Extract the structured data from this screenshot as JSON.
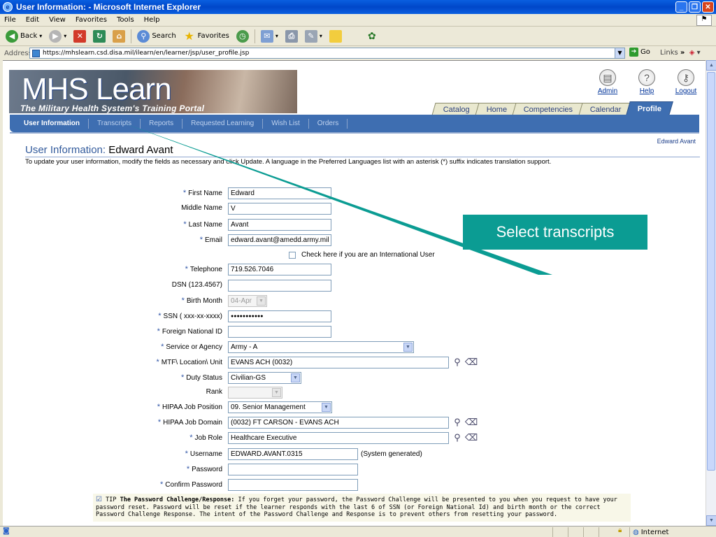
{
  "window": {
    "title": "User Information: - Microsoft Internet Explorer"
  },
  "menu": [
    "File",
    "Edit",
    "View",
    "Favorites",
    "Tools",
    "Help"
  ],
  "toolbar": {
    "back": "Back",
    "search": "Search",
    "favorites": "Favorites"
  },
  "address": {
    "label": "Address",
    "url": "https://mhslearn.csd.disa.mil/ilearn/en/learner/jsp/user_profile.jsp",
    "go": "Go",
    "links": "Links"
  },
  "header": {
    "logo_main": "MHS Learn",
    "logo_sub": "The Military Health System's Training Portal",
    "admin": "Admin",
    "help": "Help",
    "logout": "Logout"
  },
  "tabs": [
    "Catalog",
    "Home",
    "Competencies",
    "Calendar",
    "Profile"
  ],
  "subnav": [
    "User Information",
    "Transcripts",
    "Reports",
    "Requested Learning",
    "Wish List",
    "Orders"
  ],
  "page": {
    "user_right": "Edward Avant",
    "title_prefix": "User Information:",
    "title_name": "Edward Avant",
    "instructions": "To update your user information, modify the fields as necessary and click Update. A language in the Preferred Languages list with an asterisk (*) suffix indicates translation support."
  },
  "form": {
    "first_name": {
      "label": "First Name",
      "value": "Edward"
    },
    "middle_name": {
      "label": "Middle Name",
      "value": "V"
    },
    "last_name": {
      "label": "Last Name",
      "value": "Avant"
    },
    "email": {
      "label": "Email",
      "value": "edward.avant@amedd.army.mil"
    },
    "intl_user": {
      "label": "Check here if you are an International User"
    },
    "telephone": {
      "label": "Telephone",
      "value": "719.526.7046"
    },
    "dsn": {
      "label": "DSN (123.4567)",
      "value": ""
    },
    "birth_month": {
      "label": "Birth Month",
      "value": "04-Apr"
    },
    "ssn": {
      "label": "SSN ( xxx-xx-xxxx)",
      "value": "●●●●●●●●●●●"
    },
    "foreign_id": {
      "label": "Foreign National ID",
      "value": ""
    },
    "service": {
      "label": "Service or Agency",
      "value": "Army - A"
    },
    "mtf": {
      "label": "MTF\\ Location\\ Unit",
      "value": "EVANS ACH (0032)"
    },
    "duty_status": {
      "label": "Duty Status",
      "value": "Civilian-GS"
    },
    "rank": {
      "label": "Rank",
      "value": ""
    },
    "hipaa_position": {
      "label": "HIPAA Job Position",
      "value": "09. Senior Management"
    },
    "hipaa_domain": {
      "label": "HIPAA Job Domain",
      "value": "(0032) FT CARSON - EVANS ACH"
    },
    "job_role": {
      "label": "Job Role",
      "value": "Healthcare Executive"
    },
    "username": {
      "label": "Username",
      "value": "EDWARD.AVANT.0315",
      "note": "(System generated)"
    },
    "password": {
      "label": "Password",
      "value": ""
    },
    "confirm_password": {
      "label": "Confirm Password",
      "value": ""
    }
  },
  "tip": {
    "prefix": "TIP",
    "heading": "The Password Challenge/Response:",
    "text": "If you forget your password, the Password Challenge will be presented to you when you request to have your password reset. Password will be reset if the learner responds with the last 6 of SSN (or Foreign National Id) and birth month or the correct Password Challenge Response. The intent of the Password Challenge and Response is to prevent others from resetting your password."
  },
  "callout": {
    "text": "Select transcripts",
    "color": "#0b9c93"
  },
  "status": {
    "zone": "Internet"
  },
  "colors": {
    "nav_blue": "#3e6eb1",
    "title_blue": "#335b9c",
    "xp_title": "#0a5fe0"
  }
}
